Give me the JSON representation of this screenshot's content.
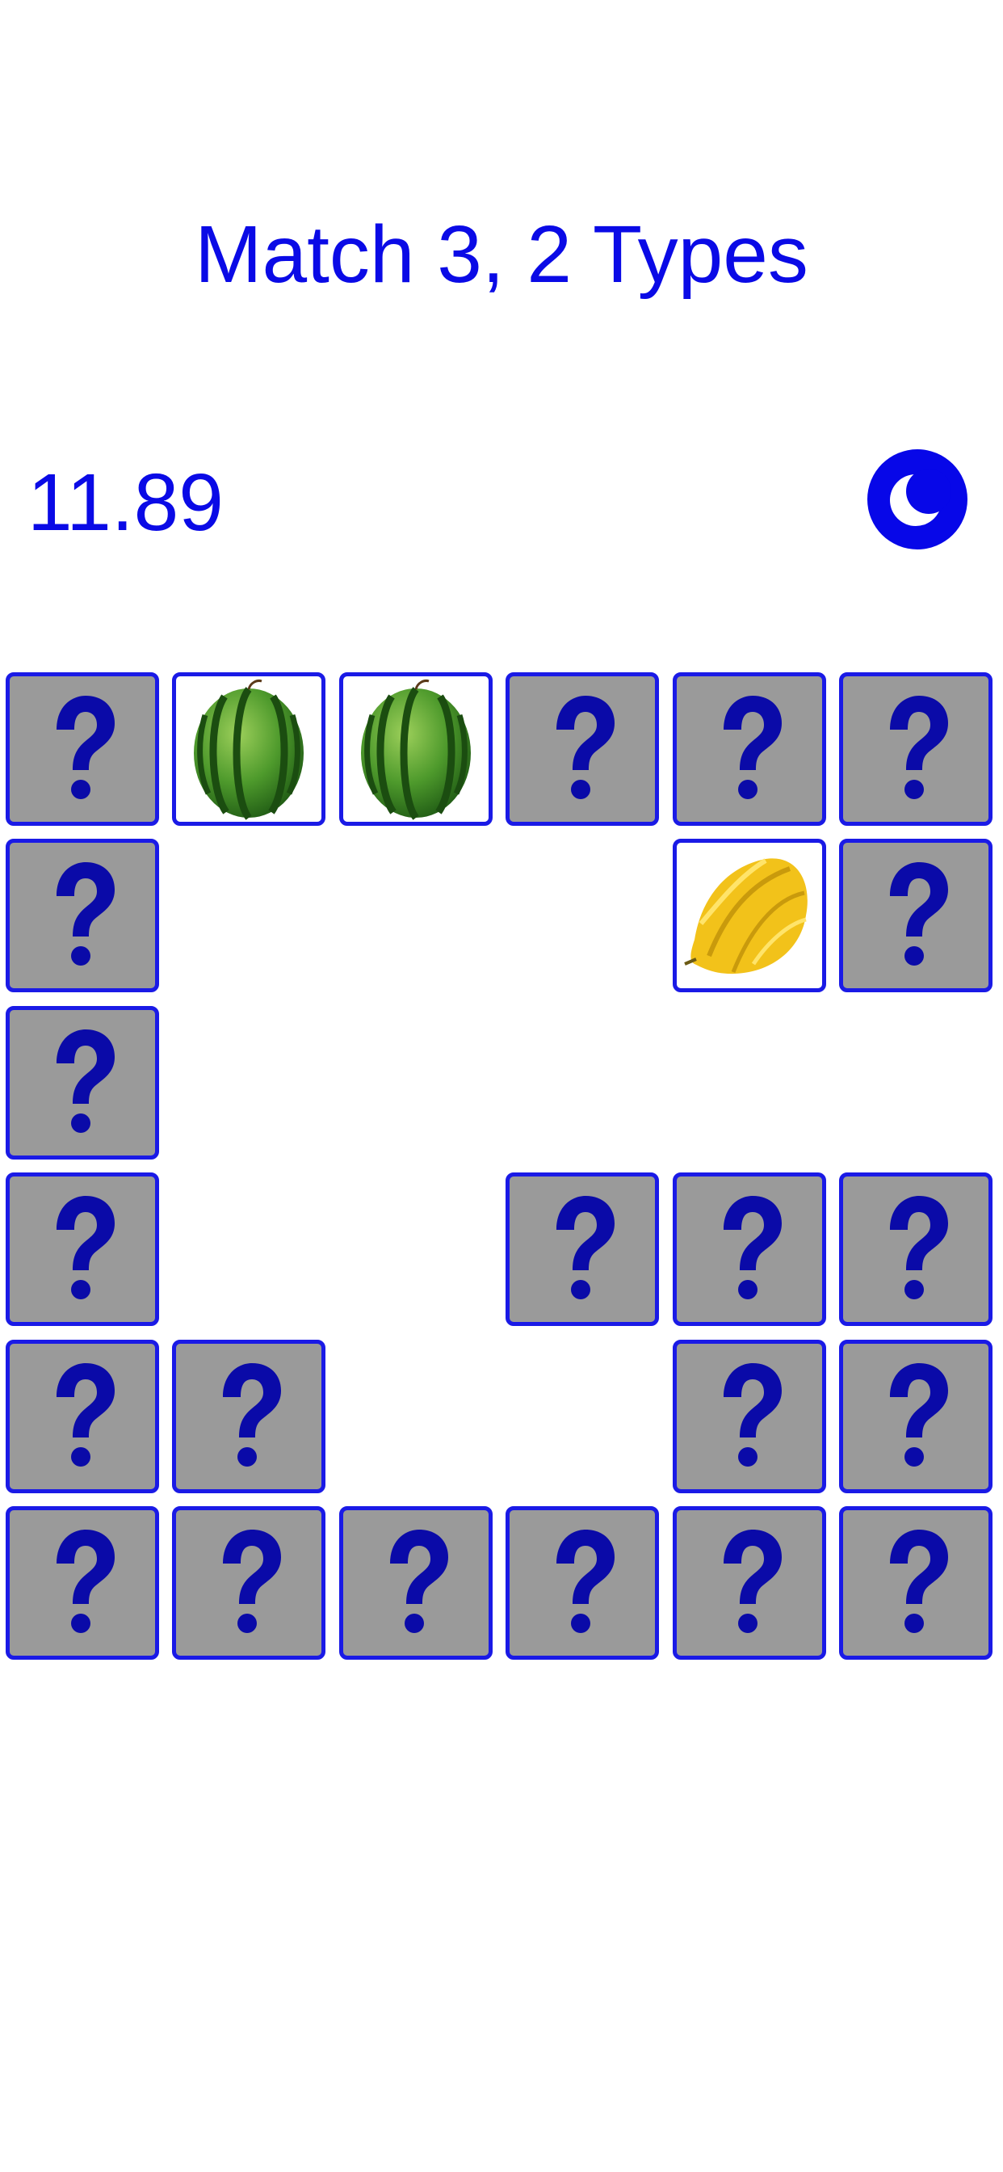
{
  "title": "Match 3, 2 Types",
  "timer": "11.89",
  "theme_toggle": {
    "icon": "moon-icon"
  },
  "colors": {
    "text": "#0a0ae6",
    "card_border": "#1a1ae6",
    "card_back": "#9a9a9a",
    "question_mark": "#0a0aa8"
  },
  "board": {
    "rows": 6,
    "cols": 6,
    "cards": [
      [
        "hidden",
        "watermelon",
        "watermelon",
        "hidden",
        "hidden",
        "hidden"
      ],
      [
        "hidden",
        "empty",
        "empty",
        "empty",
        "starfruit",
        "hidden"
      ],
      [
        "hidden",
        "empty",
        "empty",
        "empty",
        "empty",
        "empty"
      ],
      [
        "hidden",
        "empty",
        "empty",
        "hidden",
        "hidden",
        "hidden"
      ],
      [
        "hidden",
        "hidden",
        "empty",
        "empty",
        "hidden",
        "hidden"
      ],
      [
        "hidden",
        "hidden",
        "hidden",
        "hidden",
        "hidden",
        "hidden"
      ]
    ]
  }
}
